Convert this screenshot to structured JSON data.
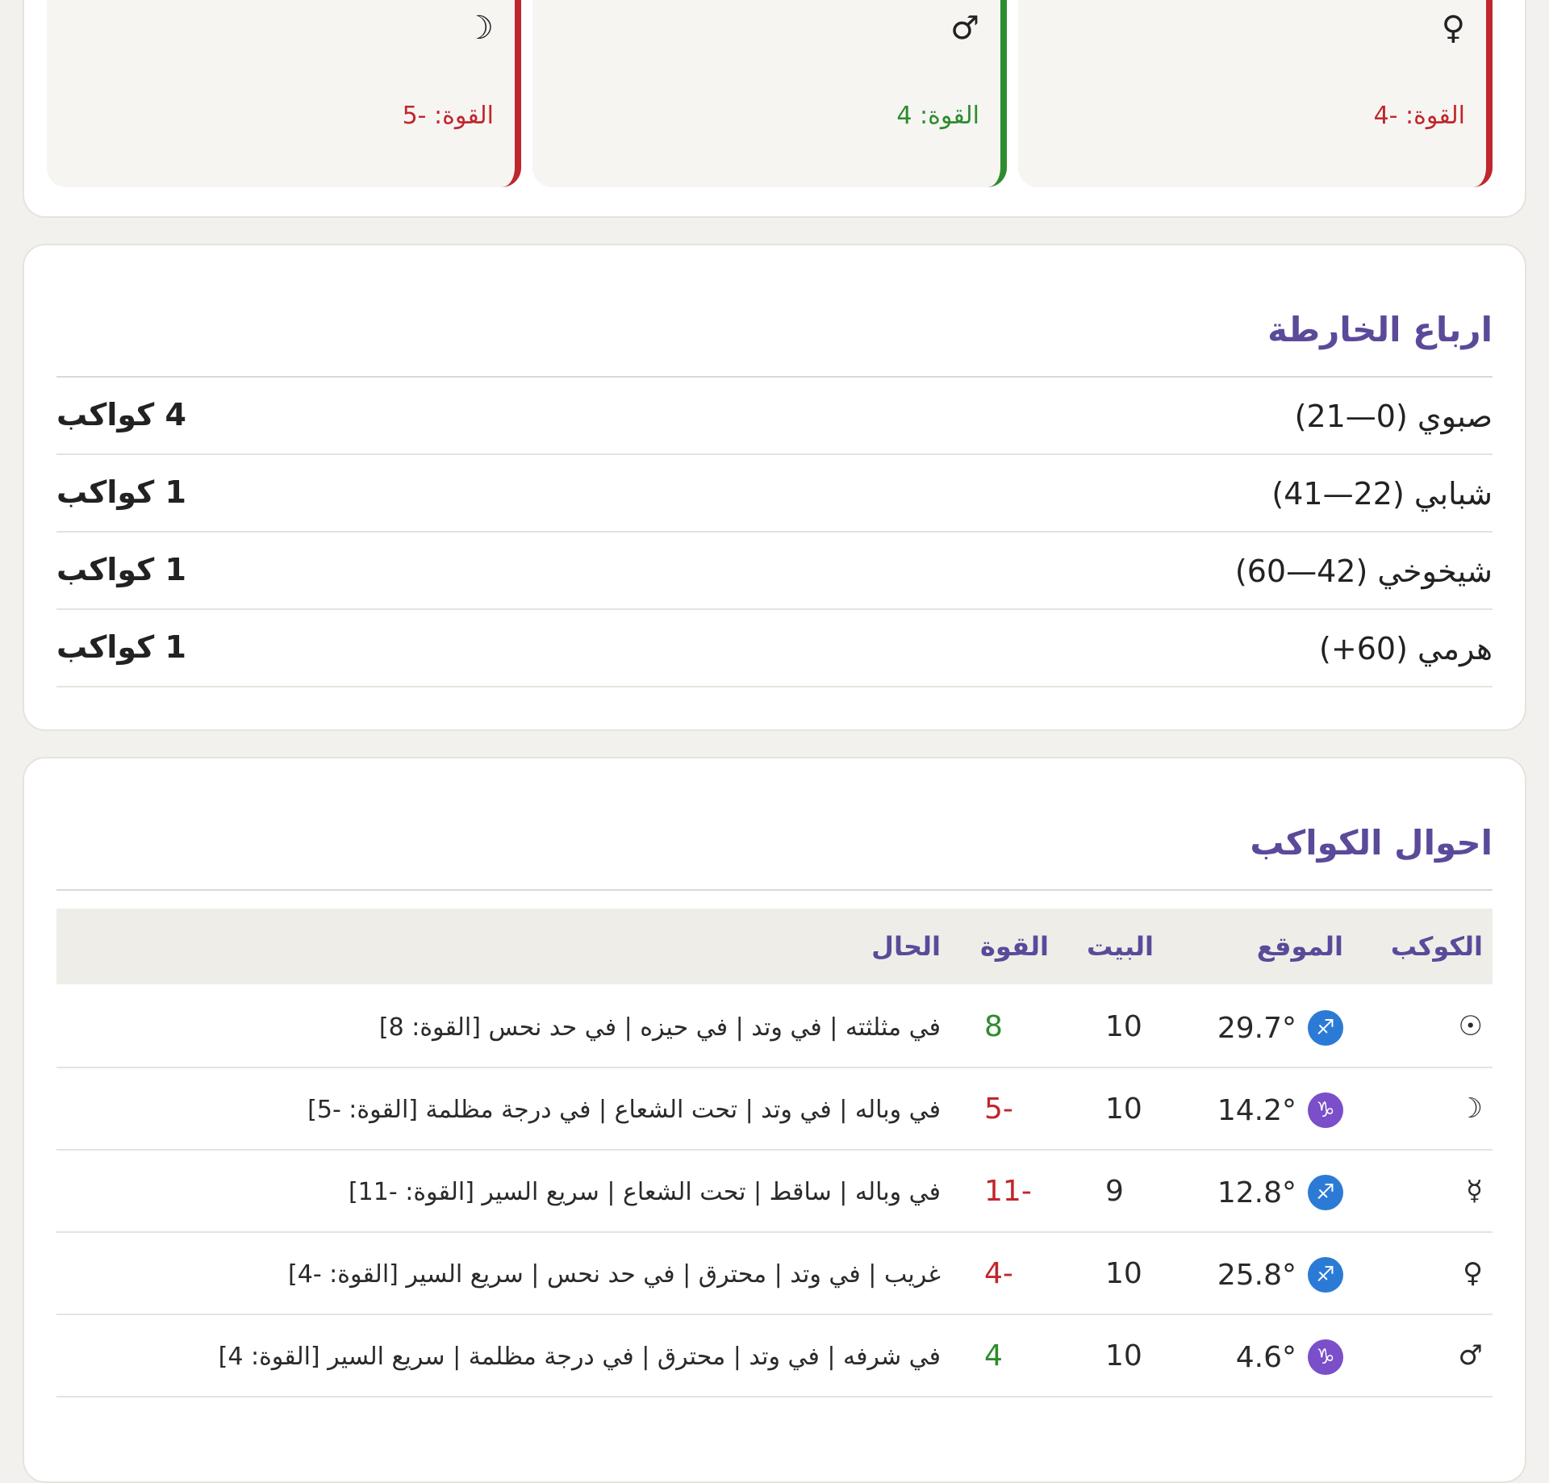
{
  "top_cards": [
    {
      "symbol": "♀",
      "power_text": "القوة: -4",
      "tone": "neg"
    },
    {
      "symbol": "♂",
      "power_text": "القوة: 4",
      "tone": "pos"
    },
    {
      "symbol": "☽",
      "power_text": "القوة: -5",
      "tone": "neg"
    }
  ],
  "quarters": {
    "title": "ارباع الخارطة",
    "rows": [
      {
        "label": "صبوي (0—21)",
        "count": "4 كواكب"
      },
      {
        "label": "شبابي (22—41)",
        "count": "1 كواكب"
      },
      {
        "label": "شيخوخي (42—60)",
        "count": "1 كواكب"
      },
      {
        "label": "هرمي (60+)",
        "count": "1 كواكب"
      }
    ]
  },
  "planets": {
    "title": "احوال الكواكب",
    "headers": {
      "planet": "الكوكب",
      "position": "الموقع",
      "house": "البيت",
      "power": "القوة",
      "status": "الحال"
    },
    "rows": [
      {
        "planet": "☉",
        "sign": "♐",
        "sign_color": "#2b7bd6",
        "degree": "29.7°",
        "house": "10",
        "power": "8",
        "tone": "pos",
        "status": "في مثلثته | في وتد | في حيزه | في حد نحس [القوة: 8]"
      },
      {
        "planet": "☽",
        "sign": "♑",
        "sign_color": "#7a4fc9",
        "degree": "14.2°",
        "house": "10",
        "power": "-5",
        "tone": "neg",
        "status": "في وباله | في وتد | تحت الشعاع | في درجة مظلمة [القوة: -5]"
      },
      {
        "planet": "☿",
        "sign": "♐",
        "sign_color": "#2b7bd6",
        "degree": "12.8°",
        "house": "9",
        "power": "-11",
        "tone": "neg",
        "status": "في وباله | ساقط | تحت الشعاع | سريع السير [القوة: -11]"
      },
      {
        "planet": "♀",
        "sign": "♐",
        "sign_color": "#2b7bd6",
        "degree": "25.8°",
        "house": "10",
        "power": "-4",
        "tone": "neg",
        "status": "غريب | في وتد | محترق | في حد نحس | سريع السير [القوة: -4]"
      },
      {
        "planet": "♂",
        "sign": "♑",
        "sign_color": "#7a4fc9",
        "degree": "4.6°",
        "house": "10",
        "power": "4",
        "tone": "pos",
        "status": "في شرفه | في وتد | محترق | في درجة مظلمة | سريع السير [القوة: 4]"
      }
    ]
  }
}
